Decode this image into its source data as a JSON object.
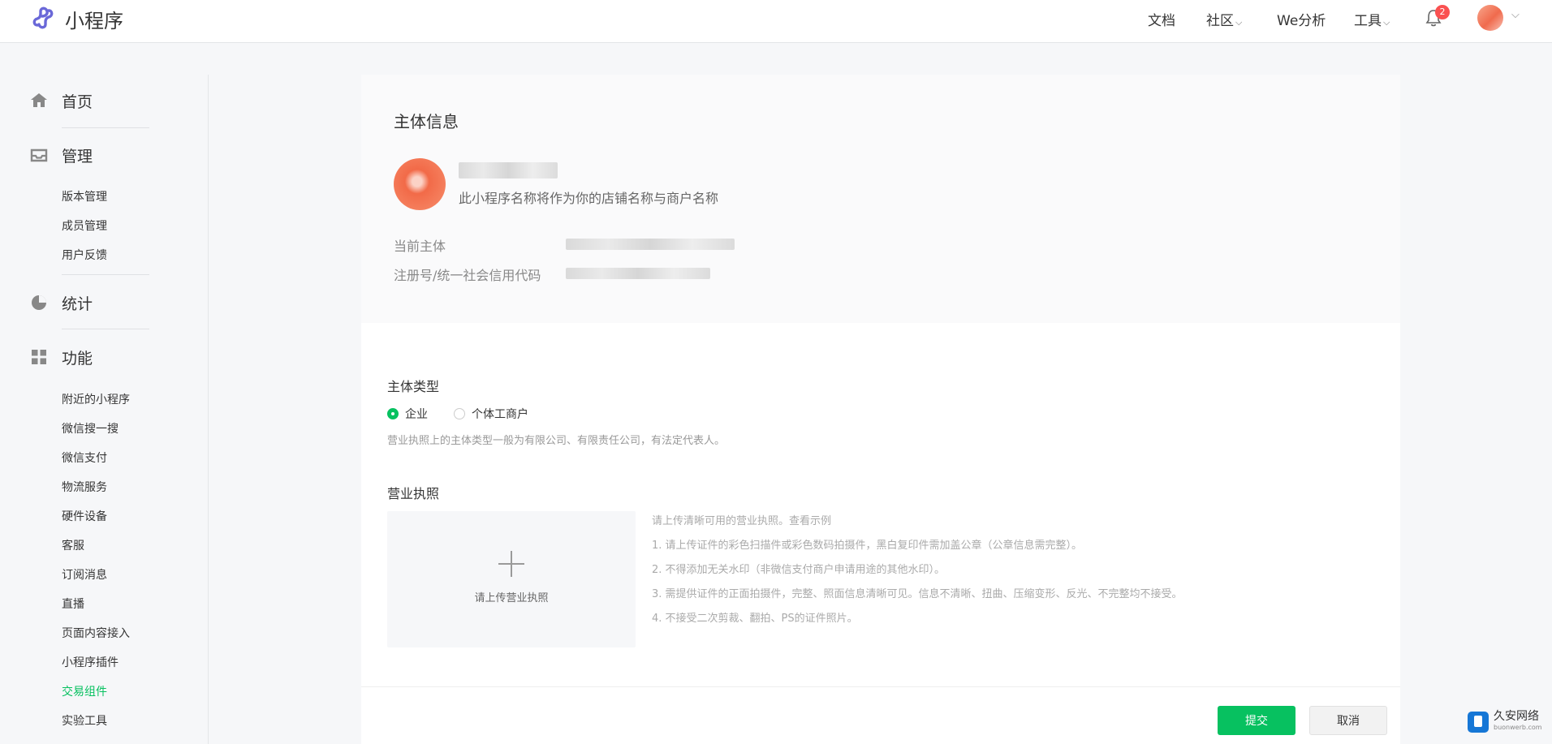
{
  "header": {
    "brand": "小程序",
    "nav": [
      {
        "label": "文档",
        "has_dropdown": false
      },
      {
        "label": "社区",
        "has_dropdown": true
      },
      {
        "label": "We分析",
        "has_dropdown": false
      },
      {
        "label": "工具",
        "has_dropdown": true
      }
    ],
    "notification_count": "2",
    "caret": "⌵"
  },
  "sidebar": {
    "sections": [
      {
        "label": "首页",
        "icon": "home-icon",
        "items": []
      },
      {
        "label": "管理",
        "icon": "inbox-icon",
        "items": [
          "版本管理",
          "成员管理",
          "用户反馈"
        ]
      },
      {
        "label": "统计",
        "icon": "pie-chart-icon",
        "items": []
      },
      {
        "label": "功能",
        "icon": "grid-icon",
        "items": [
          "附近的小程序",
          "微信搜一搜",
          "微信支付",
          "物流服务",
          "硬件设备",
          "客服",
          "订阅消息",
          "直播",
          "页面内容接入",
          "小程序插件",
          "交易组件",
          "实验工具"
        ]
      }
    ],
    "active_item": "交易组件"
  },
  "entity_info": {
    "title": "主体信息",
    "store_note": "此小程序名称将作为你的店铺名称与商户名称",
    "current_entity_label": "当前主体",
    "credit_code_label": "注册号/统一社会信用代码"
  },
  "entity_type": {
    "title": "主体类型",
    "options": [
      "企业",
      "个体工商户"
    ],
    "selected": "企业",
    "hint": "营业执照上的主体类型一般为有限公司、有限责任公司，有法定代表人。"
  },
  "license": {
    "title": "营业执照",
    "upload_label": "请上传营业执照",
    "rules_intro": "请上传清晰可用的营业执照。",
    "example_link": "查看示例",
    "rules": [
      "1. 请上传证件的彩色扫描件或彩色数码拍摄件，黑白复印件需加盖公章（公章信息需完整）。",
      "2. 不得添加无关水印（非微信支付商户申请用途的其他水印）。",
      "3. 需提供证件的正面拍摄件，完整、照面信息清晰可见。信息不清晰、扭曲、压缩变形、反光、不完整均不接受。",
      "4. 不接受二次剪裁、翻拍、PS的证件照片。"
    ]
  },
  "actions": {
    "submit": "提交",
    "cancel": "取消"
  },
  "watermark": {
    "title": "久安网络",
    "subtitle": "buonwerb.com"
  },
  "colors": {
    "primary": "#07c160",
    "badge": "#fa5151",
    "text": "#353535",
    "muted": "#999999"
  }
}
